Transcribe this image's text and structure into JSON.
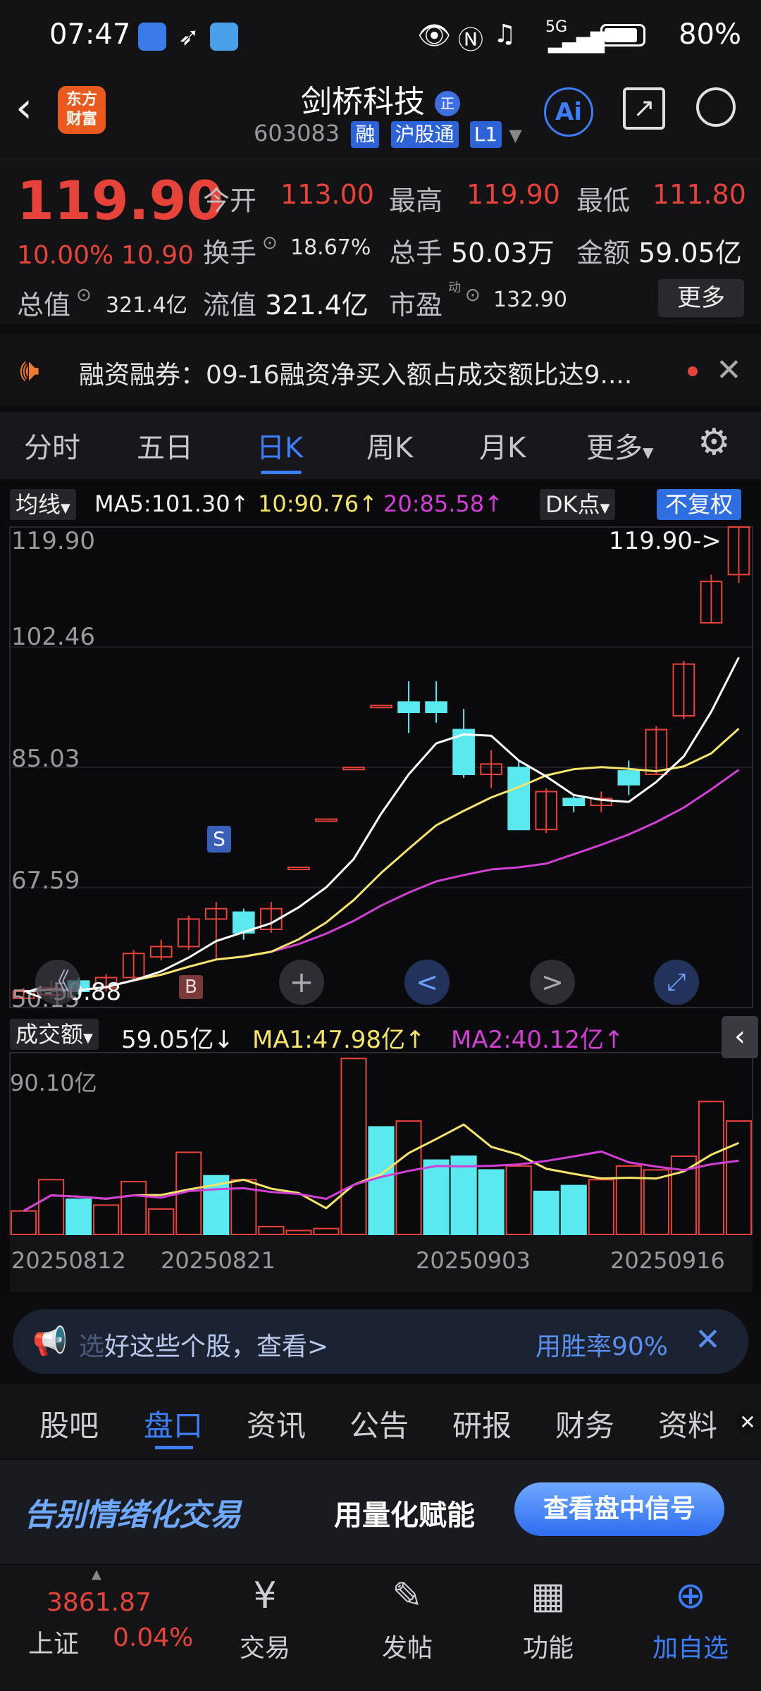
{
  "status": {
    "time": "07:47",
    "battery": "80%",
    "network": "5G"
  },
  "header": {
    "name": "剑桥科技",
    "badge": "正",
    "code": "603083",
    "tags": [
      "融",
      "沪股通",
      "L1"
    ],
    "ai_label": "Ai",
    "logo": "东方\n财富",
    "logo_line1": "东方",
    "logo_line2": "财富"
  },
  "quote": {
    "price": "119.90",
    "change_pct": "10.00%",
    "change_amt": "10.90",
    "open_label": "今开",
    "open": "113.00",
    "high_label": "最高",
    "high": "119.90",
    "low_label": "最低",
    "low": "111.80",
    "turnover_label": "换手",
    "turnover": "18.67%",
    "volume_label": "总手",
    "volume": "50.03万",
    "amount_label": "金额",
    "amount": "59.05亿",
    "mktcap_label": "总值",
    "mktcap": "321.4亿",
    "float_label": "流值",
    "float": "321.4亿",
    "pe_label": "市盈",
    "pe_sup": "动",
    "pe": "132.90",
    "more": "更多"
  },
  "notice": {
    "text": "融资融券：09-16融资净买入额占成交额比达9...."
  },
  "kline_tabs": [
    "分时",
    "五日",
    "日K",
    "周K",
    "月K",
    "更多"
  ],
  "kline_active": "日K",
  "ma": {
    "selector": "均线",
    "ma5": "MA5:101.30↑",
    "ma10": "10:90.76↑",
    "ma20": "20:85.58↑",
    "dk": "DK点",
    "adjust": "不复权"
  },
  "price_axis": [
    "119.90",
    "102.46",
    "85.03",
    "67.59",
    "50.15"
  ],
  "last_price_tag": "119.90->",
  "low_marker": "<-50.88",
  "signals": {
    "sell": "S",
    "buy": "B"
  },
  "volume": {
    "selector": "成交额",
    "value": "59.05亿↓",
    "ma1": "MA1:47.98亿↑",
    "ma2": "MA2:40.12亿↑",
    "max_label": "90.10亿"
  },
  "dates": [
    "20250812",
    "20250821",
    "20250903",
    "20250916"
  ],
  "chart_data": {
    "type": "candlestick",
    "ylim": [
      50.15,
      119.9
    ],
    "candles": [
      {
        "o": 51.5,
        "c": 52.5,
        "h": 53.0,
        "l": 51.0,
        "up": true
      },
      {
        "o": 52.0,
        "c": 53.0,
        "h": 54.0,
        "l": 51.5,
        "up": true
      },
      {
        "o": 54.0,
        "c": 52.5,
        "h": 54.5,
        "l": 52.0,
        "up": false
      },
      {
        "o": 53.0,
        "c": 54.5,
        "h": 55.0,
        "l": 52.5,
        "up": true
      },
      {
        "o": 54.5,
        "c": 58.0,
        "h": 58.5,
        "l": 54.0,
        "up": true
      },
      {
        "o": 57.5,
        "c": 59.0,
        "h": 60.0,
        "l": 57.0,
        "up": true
      },
      {
        "o": 59.0,
        "c": 63.0,
        "h": 63.5,
        "l": 58.5,
        "up": true
      },
      {
        "o": 63.0,
        "c": 64.5,
        "h": 65.5,
        "l": 57.0,
        "up": true
      },
      {
        "o": 64.0,
        "c": 61.0,
        "h": 64.5,
        "l": 60.0,
        "up": false
      },
      {
        "o": 61.5,
        "c": 64.5,
        "h": 65.5,
        "l": 61.0,
        "up": true
      },
      {
        "o": 70.5,
        "c": 70.5,
        "h": 70.5,
        "l": 70.5,
        "up": true
      },
      {
        "o": 77.5,
        "c": 77.5,
        "h": 77.5,
        "l": 77.5,
        "up": true
      },
      {
        "o": 85.0,
        "c": 85.0,
        "h": 85.0,
        "l": 85.0,
        "up": true
      },
      {
        "o": 94.0,
        "c": 94.0,
        "h": 94.0,
        "l": 94.0,
        "up": true
      },
      {
        "o": 94.5,
        "c": 93.0,
        "h": 97.5,
        "l": 90.0,
        "up": false
      },
      {
        "o": 94.5,
        "c": 93.0,
        "h": 97.5,
        "l": 91.5,
        "up": false
      },
      {
        "o": 90.5,
        "c": 84.0,
        "h": 93.5,
        "l": 83.5,
        "up": false
      },
      {
        "o": 85.5,
        "c": 84.0,
        "h": 87.5,
        "l": 82.0,
        "up": true
      },
      {
        "o": 85.0,
        "c": 76.0,
        "h": 86.0,
        "l": 76.0,
        "up": false
      },
      {
        "o": 76.0,
        "c": 81.5,
        "h": 82.0,
        "l": 75.5,
        "up": true
      },
      {
        "o": 80.5,
        "c": 79.5,
        "h": 81.0,
        "l": 78.5,
        "up": false
      },
      {
        "o": 79.5,
        "c": 80.5,
        "h": 81.5,
        "l": 78.5,
        "up": true
      },
      {
        "o": 84.5,
        "c": 82.5,
        "h": 86.0,
        "l": 81.0,
        "up": false
      },
      {
        "o": 84.0,
        "c": 90.5,
        "h": 91.0,
        "l": 84.0,
        "up": true
      },
      {
        "o": 92.5,
        "c": 100.0,
        "h": 100.5,
        "l": 92.0,
        "up": true
      },
      {
        "o": 106.0,
        "c": 112.0,
        "h": 113.0,
        "l": 106.0,
        "up": true
      },
      {
        "o": 113.0,
        "c": 119.9,
        "h": 119.9,
        "l": 111.8,
        "up": true
      }
    ],
    "volumes": [
      12,
      28,
      18,
      15,
      27,
      13,
      42,
      30,
      28,
      4,
      2,
      3,
      90,
      55,
      58,
      38,
      40,
      33,
      35,
      22,
      25,
      28,
      35,
      33,
      40,
      68,
      58
    ],
    "vol_up": [
      true,
      true,
      false,
      true,
      true,
      true,
      true,
      false,
      true,
      true,
      true,
      true,
      true,
      false,
      true,
      false,
      false,
      false,
      true,
      false,
      false,
      true,
      true,
      true,
      true,
      true,
      true
    ]
  },
  "chart_controls": {
    "prev": "《",
    "plus": "+",
    "left": "<",
    "right": ">",
    "expand": "⤢"
  },
  "promo": {
    "text_fade": "选",
    "text": "好这些个股，查看>",
    "right": "用胜率90%"
  },
  "section_tabs": [
    "股吧",
    "盘口",
    "资讯",
    "公告",
    "研报",
    "财务",
    "资料"
  ],
  "section_active": "盘口",
  "ad": {
    "title": "告别情绪化交易",
    "subtitle": "用量化赋能",
    "button": "查看盘中信号"
  },
  "bottom": {
    "index_value": "3861.87",
    "index_name": "上证",
    "index_change": "0.04%",
    "items": [
      "交易",
      "发帖",
      "功能",
      "加自选"
    ]
  },
  "colors": {
    "up": "#e8433a",
    "down": "#5be9f0",
    "ma5": "#ffffff",
    "ma10": "#f5e56b",
    "ma20": "#d23fd4",
    "accent": "#3d7eff"
  }
}
